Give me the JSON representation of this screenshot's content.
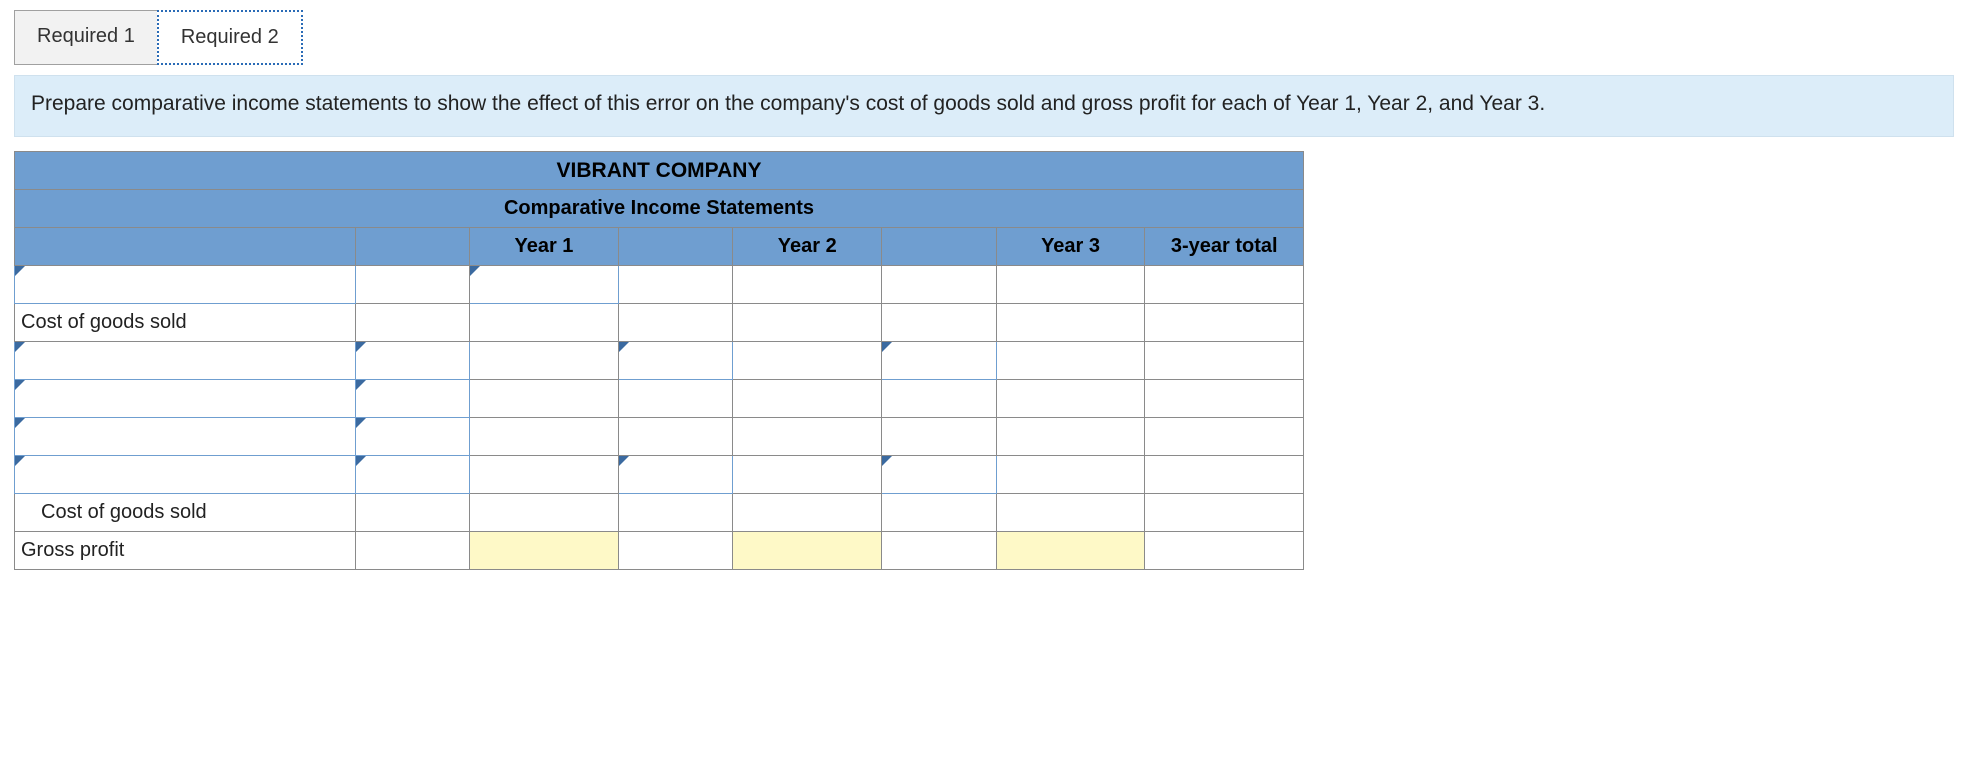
{
  "tabs": [
    {
      "label": "Required 1",
      "active": false
    },
    {
      "label": "Required 2",
      "active": true
    }
  ],
  "instruction": "Prepare comparative income statements to show the effect of this error on the company's cost of goods sold and gross profit for each of Year 1, Year 2, and Year 3.",
  "table": {
    "company": "VIBRANT COMPANY",
    "report_title": "Comparative Income Statements",
    "columns": {
      "year1": "Year 1",
      "year2": "Year 2",
      "year3": "Year 3",
      "total": "3-year total"
    },
    "rows": {
      "cogs_header": "Cost of goods sold",
      "cogs_total": "Cost of goods sold",
      "gross_profit": "Gross profit"
    }
  }
}
